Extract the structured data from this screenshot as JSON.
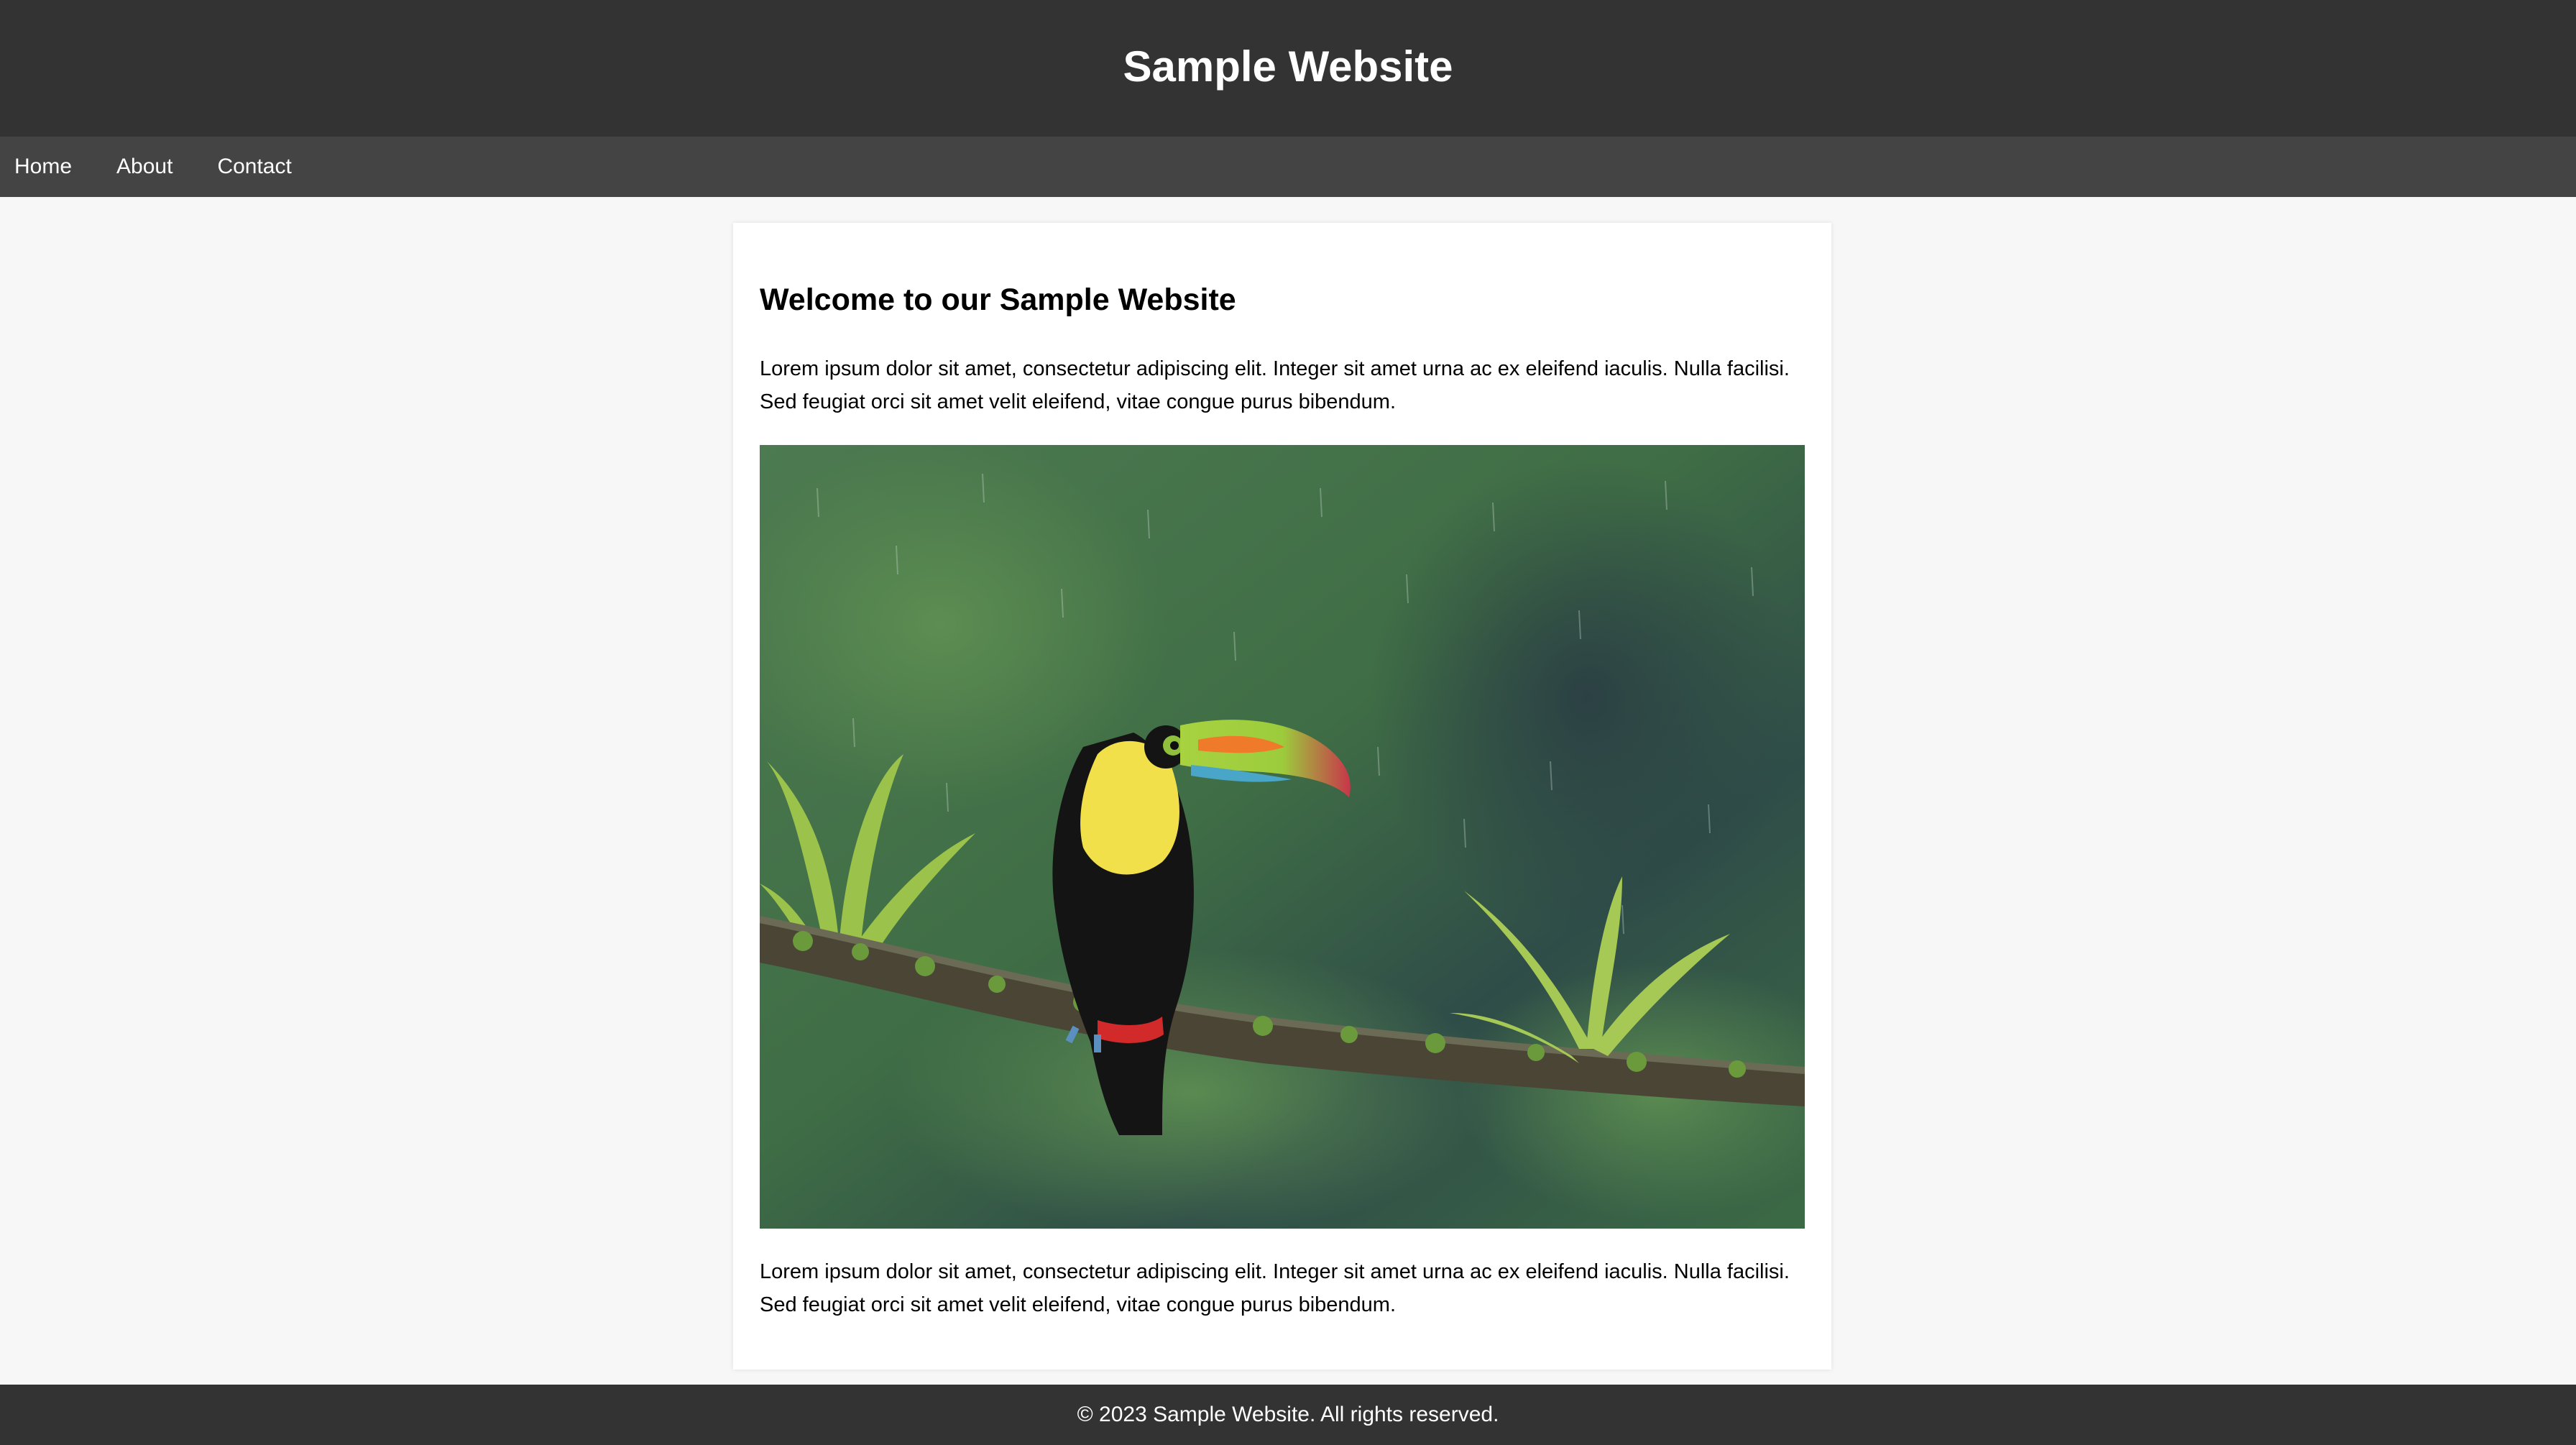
{
  "header": {
    "title": "Sample Website"
  },
  "nav": {
    "items": [
      {
        "label": "Home"
      },
      {
        "label": "About"
      },
      {
        "label": "Contact"
      }
    ]
  },
  "main": {
    "heading": "Welcome to our Sample Website",
    "paragraph_1": "Lorem ipsum dolor sit amet, consectetur adipiscing elit. Integer sit amet urna ac ex eleifend iaculis. Nulla facilisi. Sed feugiat orci sit amet velit eleifend, vitae congue purus bibendum.",
    "image": {
      "subject": "toucan-on-branch-photo"
    },
    "paragraph_2": "Lorem ipsum dolor sit amet, consectetur adipiscing elit. Integer sit amet urna ac ex eleifend iaculis. Nulla facilisi. Sed feugiat orci sit amet velit eleifend, vitae congue purus bibendum."
  },
  "footer": {
    "text": "© 2023 Sample Website. All rights reserved."
  },
  "colors": {
    "header_bg": "#333333",
    "nav_bg": "#444444",
    "page_bg": "#f7f7f7",
    "card_bg": "#ffffff",
    "footer_bg": "#333333"
  }
}
